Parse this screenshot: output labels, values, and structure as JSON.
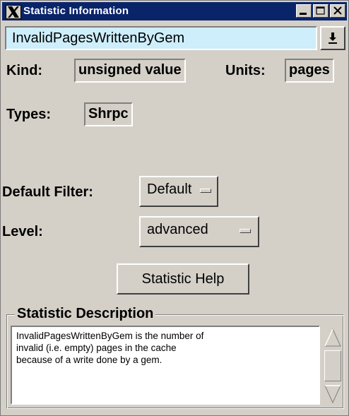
{
  "window": {
    "title": "Statistic Information",
    "buttons": [
      "minimize",
      "maximize",
      "close"
    ]
  },
  "statistic": {
    "name": "InvalidPagesWrittenByGem",
    "kind_label": "Kind:",
    "kind_value": "unsigned value",
    "units_label": "Units:",
    "units_value": "pages",
    "types_label": "Types:",
    "types_value": "Shrpc"
  },
  "filter": {
    "label": "Default Filter:",
    "value": "Default"
  },
  "level": {
    "label": "Level:",
    "value": "advanced"
  },
  "help_button": "Statistic Help",
  "description": {
    "title": "Statistic Description",
    "lines": [
      "InvalidPagesWrittenByGem is the number of",
      "invalid (i.e. empty) pages in the cache",
      "because of a write done by a gem."
    ]
  },
  "colors": {
    "titlebar": "#0a246a",
    "field_highlight": "#cdeefa",
    "window_bg": "#d4d0c8"
  }
}
